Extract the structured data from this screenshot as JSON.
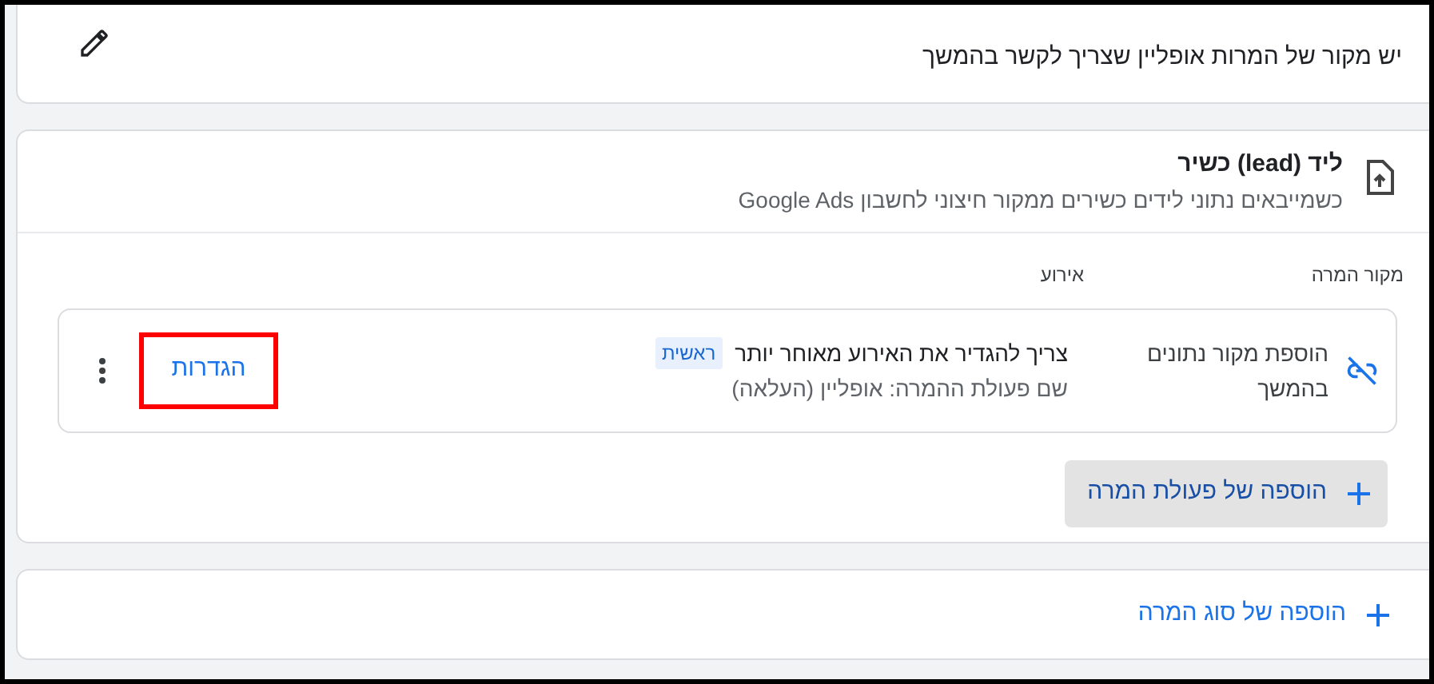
{
  "notice": {
    "text": "יש מקור של המרות אופליין שצריך לקשר בהמשך"
  },
  "conversion_type": {
    "title": "ליד (lead) כשיר",
    "description": "כשמייבאים נתוני לידים כשירים ממקור חיצוני לחשבון Google Ads",
    "columns": [
      "מקור המרה",
      "אירוע"
    ],
    "rows": [
      {
        "source": "הוספת מקור נתונים בהמשך",
        "event": "צריך להגדיר את האירוע מאוחר יותר",
        "badge": "ראשית",
        "action_name": "שם פעולת ההמרה: אופליין (העלאה)",
        "settings_link": "הגדרות",
        "highlighted": true
      }
    ],
    "add_action_button": "הוספה של פעולת המרה"
  },
  "add_type_button": "הוספה של סוג המרה"
}
